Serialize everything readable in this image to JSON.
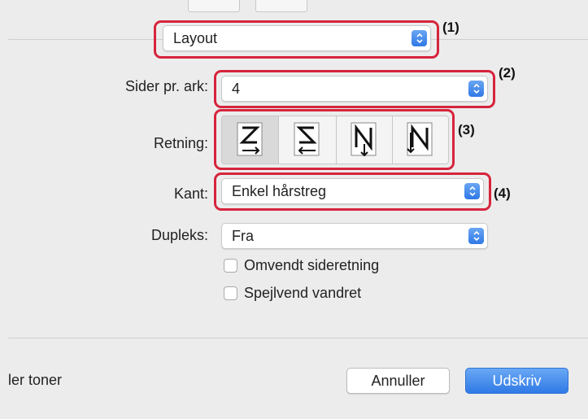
{
  "panel_select": {
    "value": "Layout"
  },
  "pages_per_sheet": {
    "label": "Sider pr. ark:",
    "value": "4"
  },
  "orientation": {
    "label": "Retning:",
    "options": [
      "Z",
      "S-reverse",
      "N-reverse",
      "N"
    ]
  },
  "border": {
    "label": "Kant:",
    "value": "Enkel hårstreg"
  },
  "duplex": {
    "label": "Dupleks:",
    "value": "Fra"
  },
  "checkboxes": [
    {
      "label": "Omvendt sideretning",
      "checked": false
    },
    {
      "label": "Spejlvend vandret",
      "checked": false
    }
  ],
  "footer": {
    "left_text": "ler toner",
    "cancel_label": "Annuller",
    "print_label": "Udskriv"
  },
  "callouts": [
    "(1)",
    "(2)",
    "(3)",
    "(4)"
  ],
  "colors": {
    "callout": "#d6243c",
    "accent": "#2f78e6"
  }
}
